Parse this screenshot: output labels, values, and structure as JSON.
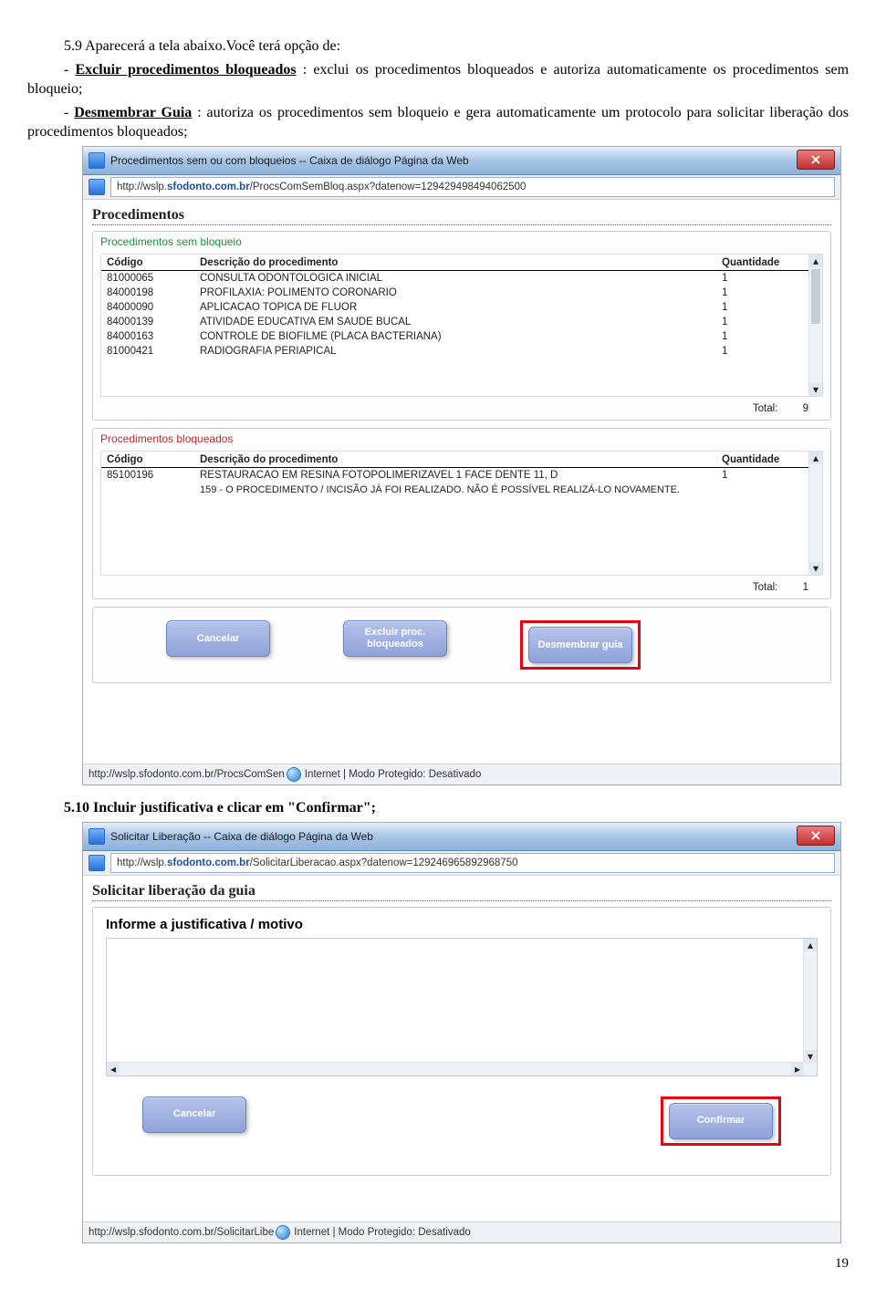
{
  "doc": {
    "p1": "5.9 Aparecerá a tela abaixo.Você terá opção de:",
    "p2a": "- ",
    "p2b": "Excluir procedimentos bloqueados",
    "p2c": ": exclui os procedimentos bloqueados e autoriza automaticamente os procedimentos sem bloqueio;",
    "p3a": "- ",
    "p3b": "Desmembrar Guia",
    "p3c": ": autoriza os procedimentos sem bloqueio e gera automaticamente um protocolo para solicitar liberação dos procedimentos bloqueados;",
    "p4": "5.10 Incluir justificativa e clicar em \"Confirmar\";",
    "page": "19"
  },
  "dlg1": {
    "title": "Procedimentos sem ou com bloqueios -- Caixa de diálogo Página da Web",
    "url_prefix": "http://wslp.",
    "url_host": "sfodonto.com.br",
    "url_path": "/ProcsComSemBloq.aspx?datenow=129429498494062500",
    "header": "Procedimentos",
    "sec1_title": "Procedimentos sem bloqueio",
    "sec2_title": "Procedimentos bloqueados",
    "col_code": "Código",
    "col_desc": "Descrição do procedimento",
    "col_qty": "Quantidade",
    "total_label": "Total:",
    "total1": "9",
    "total2": "1",
    "rows1": [
      {
        "code": "81000065",
        "desc": "CONSULTA ODONTOLOGICA INICIAL",
        "qty": "1"
      },
      {
        "code": "84000198",
        "desc": "PROFILAXIA: POLIMENTO CORONARIO",
        "qty": "1"
      },
      {
        "code": "84000090",
        "desc": "APLICACAO TOPICA DE FLUOR",
        "qty": "1"
      },
      {
        "code": "84000139",
        "desc": "ATIVIDADE EDUCATIVA EM SAUDE BUCAL",
        "qty": "1"
      },
      {
        "code": "84000163",
        "desc": "CONTROLE DE BIOFILME (PLACA BACTERIANA)",
        "qty": "1"
      },
      {
        "code": "81000421",
        "desc": "RADIOGRAFIA PERIAPICAL",
        "qty": "1"
      }
    ],
    "rows2": [
      {
        "code": "85100196",
        "desc": "RESTAURACAO EM RESINA FOTOPOLIMERIZAVEL 1 FACE DENTE 11, D",
        "qty": "1"
      }
    ],
    "note": "159 - O PROCEDIMENTO / INCISÃO JÁ FOI REALIZADO. NÃO É POSSÍVEL REALIZÁ-LO NOVAMENTE.",
    "btn_cancel": "Cancelar",
    "btn_excluir": "Excluir proc. bloqueados",
    "btn_desmembrar": "Desmembrar guia",
    "status_url": "http://wslp.sfodonto.com.br/ProcsComSen",
    "status_rest": "Internet | Modo Protegido: Desativado"
  },
  "dlg2": {
    "title": "Solicitar Liberação -- Caixa de diálogo Página da Web",
    "url_prefix": "http://wslp.",
    "url_host": "sfodonto.com.br",
    "url_path": "/SolicitarLiberacao.aspx?datenow=129246965892968750",
    "header": "Solicitar liberação da guia",
    "label": "Informe a justificativa / motivo",
    "btn_cancel": "Cancelar",
    "btn_confirm": "Confirmar",
    "status_url": "http://wslp.sfodonto.com.br/SolicitarLibe",
    "status_rest": "Internet | Modo Protegido: Desativado"
  }
}
